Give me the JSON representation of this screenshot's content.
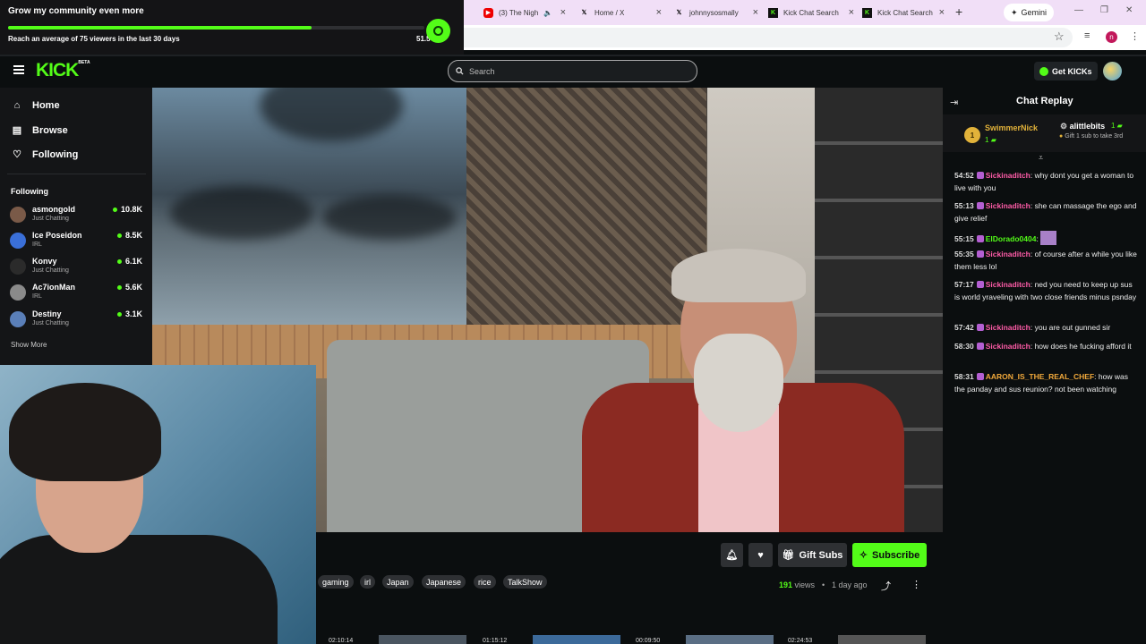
{
  "goal": {
    "title": "Grow my community even more",
    "subtitle": "Reach an average of 75 viewers in the last 30 days",
    "count": "51.5",
    "progress": 0.73
  },
  "browser": {
    "tabs": [
      {
        "title": "(3) The Nigh",
        "icon": "youtube-icon"
      },
      {
        "title": "Home / X",
        "icon": "x-icon"
      },
      {
        "title": "johnnysosmally",
        "icon": "x-icon"
      },
      {
        "title": "Kick Chat Search",
        "icon": "kick-icon"
      },
      {
        "title": "Kick Chat Search",
        "icon": "kick-icon"
      }
    ],
    "gemini_label": "Gemini",
    "profile_initial": "n"
  },
  "header": {
    "logo": "KICK",
    "logo_badge": "BETA",
    "search_placeholder": "Search",
    "get_kicks": "Get KICKs"
  },
  "sidebar": {
    "nav": [
      {
        "label": "Home",
        "icon": "home-icon"
      },
      {
        "label": "Browse",
        "icon": "browse-icon"
      },
      {
        "label": "Following",
        "icon": "heart-icon"
      }
    ],
    "following_heading": "Following",
    "channels": [
      {
        "name": "asmongold",
        "category": "Just Chatting",
        "viewers": "10.8K"
      },
      {
        "name": "Ice Poseidon",
        "category": "IRL",
        "viewers": "8.5K"
      },
      {
        "name": "Konvy",
        "category": "Just Chatting",
        "viewers": "6.1K"
      },
      {
        "name": "Ac7ionMan",
        "category": "IRL",
        "viewers": "5.6K"
      },
      {
        "name": "Destiny",
        "category": "Just Chatting",
        "viewers": "3.1K"
      }
    ],
    "show_more": "Show More"
  },
  "actions": {
    "gift_subs": "Gift Subs",
    "subscribe": "Subscribe"
  },
  "tags": [
    "gaming",
    "irl",
    "Japan",
    "Japanese",
    "rice",
    "TalkShow"
  ],
  "meta": {
    "views_count": "191",
    "views_label": "views",
    "separator": "•",
    "age": "1 day ago"
  },
  "thumbnails": [
    "02:10:14",
    "01:15:12",
    "00:09:50",
    "02:24:53"
  ],
  "chat": {
    "title": "Chat Replay",
    "top_gifters": [
      {
        "rank": "1",
        "name": "SwimmerNick",
        "count": "1"
      },
      {
        "name": "alittlebits",
        "count": "1",
        "tip": "Gift 1 sub to take 3rd"
      }
    ],
    "messages": [
      {
        "time": "54:52",
        "user": "Sickinaditch",
        "color": "#ff5ca8",
        "text": "why dont you get a woman to live with you"
      },
      {
        "time": "55:13",
        "user": "Sickinaditch",
        "color": "#ff5ca8",
        "text": "she can massage the ego and give relief"
      },
      {
        "time": "55:15",
        "user": "ElDorado0404",
        "color": "#53fc18",
        "text": ""
      },
      {
        "time": "55:35",
        "user": "Sickinaditch",
        "color": "#ff5ca8",
        "text": "of course after a while you like them less lol"
      },
      {
        "time": "57:17",
        "user": "Sickinaditch",
        "color": "#ff5ca8",
        "text": "ned you need to keep up sus is world yraveling with two close friends minus psnday"
      },
      {
        "time": "57:42",
        "user": "Sickinaditch",
        "color": "#ff5ca8",
        "text": "you are out gunned sir"
      },
      {
        "time": "58:30",
        "user": "Sickinaditch",
        "color": "#ff5ca8",
        "text": "how does he fucking afford it"
      },
      {
        "time": "58:31",
        "user": "AARON_IS_THE_REAL_CHEF",
        "color": "#f2a93b",
        "text": "how was the panday and sus reunion? not been watching"
      }
    ]
  }
}
